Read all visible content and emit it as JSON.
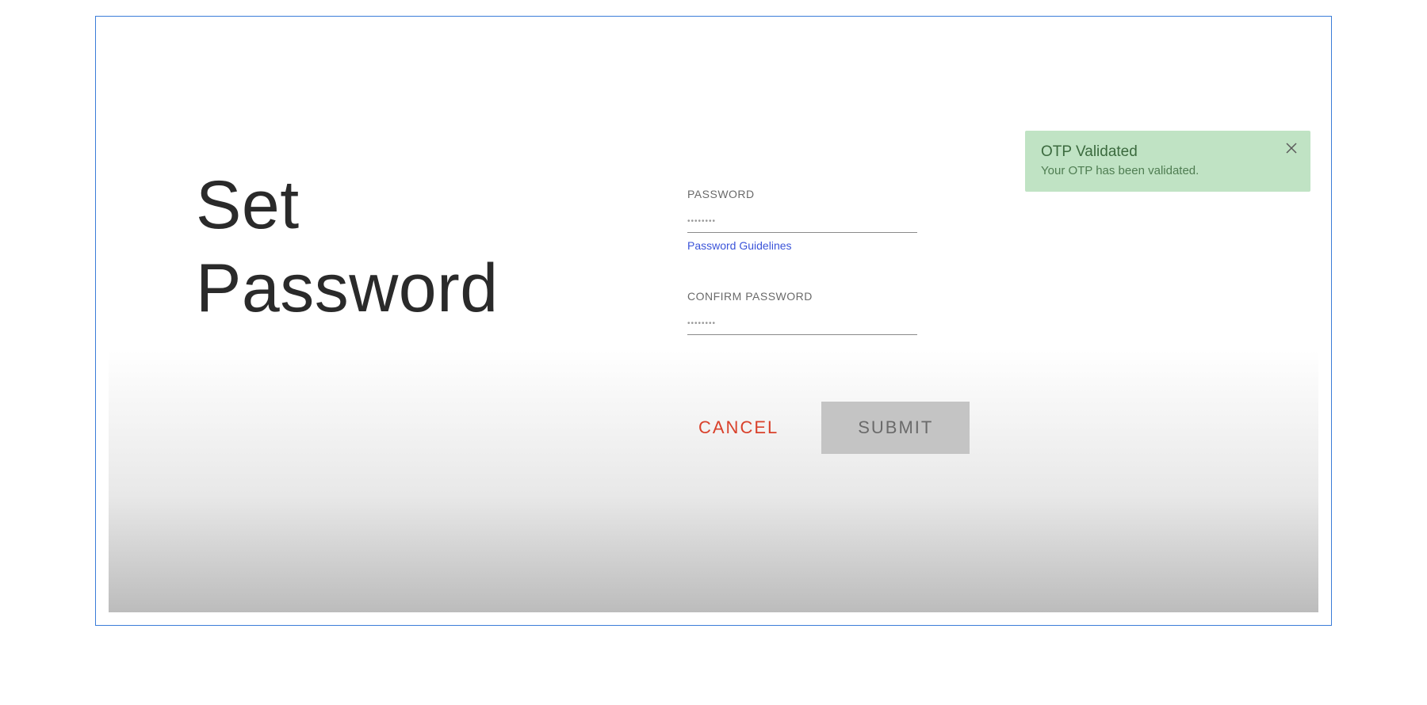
{
  "heading": {
    "line1": "Set",
    "line2": "Password"
  },
  "form": {
    "password": {
      "label": "PASSWORD",
      "placeholder": "••••••••",
      "value": ""
    },
    "guidelines_link": "Password Guidelines",
    "confirm_password": {
      "label": "CONFIRM PASSWORD",
      "placeholder": "••••••••",
      "value": ""
    }
  },
  "buttons": {
    "cancel": "CANCEL",
    "submit": "SUBMIT"
  },
  "toast": {
    "title": "OTP Validated",
    "body": "Your OTP has been validated."
  }
}
